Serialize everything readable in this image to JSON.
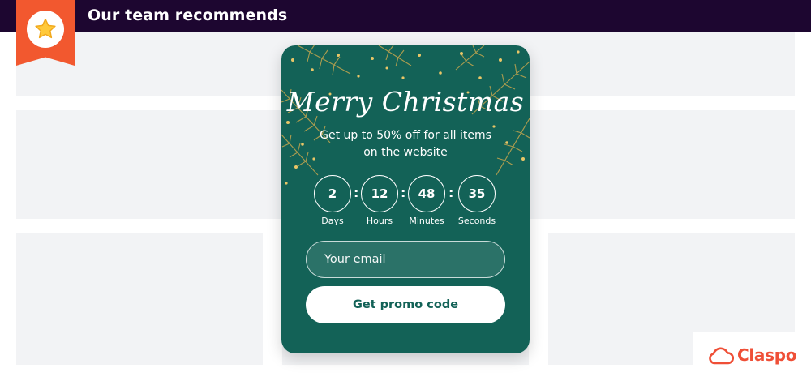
{
  "header": {
    "title": "Our team recommends",
    "badge_icon": "star-icon"
  },
  "popup": {
    "title": "Merry Christmas",
    "subtitle": "Get up to 50% off for all items on the website",
    "countdown": [
      {
        "value": "2",
        "label": "Days"
      },
      {
        "value": "12",
        "label": "Hours"
      },
      {
        "value": "48",
        "label": "Minutes"
      },
      {
        "value": "35",
        "label": "Seconds"
      }
    ],
    "email_placeholder": "Your email",
    "button_label": "Get promo code"
  },
  "brand": {
    "name": "Claspo",
    "icon": "cloud-icon"
  },
  "colors": {
    "topbar": "#1d0630",
    "ribbon": "#f2582f",
    "popup_bg": "#136257",
    "brand": "#ef4f37",
    "placeholder": "#f2f3f5"
  }
}
